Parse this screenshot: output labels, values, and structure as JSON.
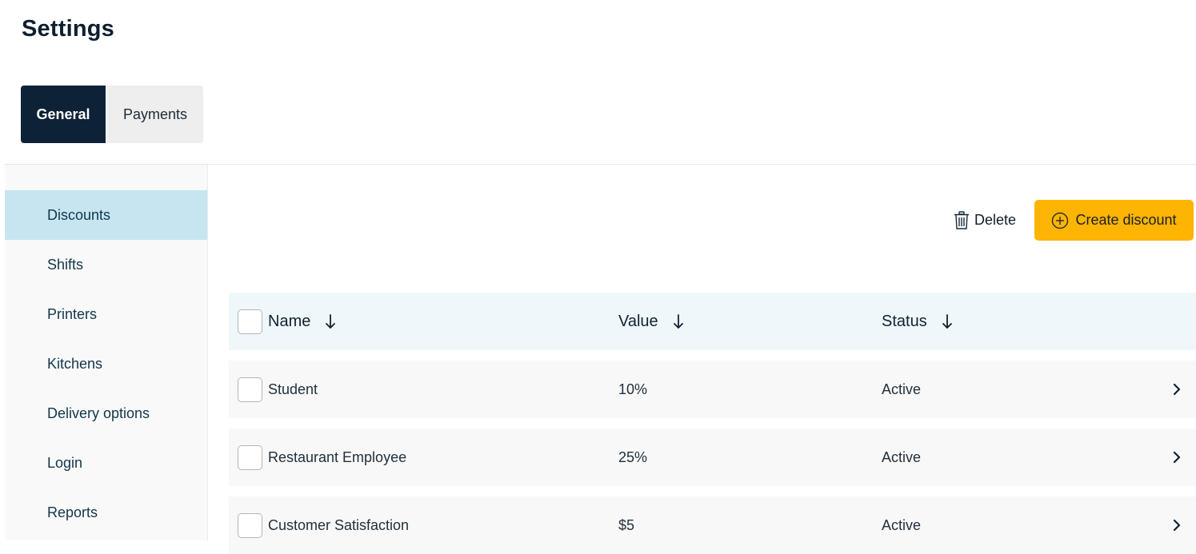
{
  "page": {
    "title": "Settings"
  },
  "tabs": [
    {
      "label": "General",
      "active": true
    },
    {
      "label": "Payments",
      "active": false
    }
  ],
  "sidebar": {
    "items": [
      {
        "label": "Discounts",
        "active": true
      },
      {
        "label": "Shifts"
      },
      {
        "label": "Printers"
      },
      {
        "label": "Kitchens"
      },
      {
        "label": "Delivery options"
      },
      {
        "label": "Login"
      },
      {
        "label": "Reports"
      }
    ]
  },
  "toolbar": {
    "delete_label": "Delete",
    "delete_icon": "trash-icon",
    "create_label": "Create discount",
    "create_icon": "plus-circle-icon"
  },
  "table": {
    "columns": [
      {
        "label": "Name",
        "sort_icon": "arrow-down-icon"
      },
      {
        "label": "Value",
        "sort_icon": "arrow-down-icon"
      },
      {
        "label": "Status",
        "sort_icon": "arrow-down-icon"
      }
    ],
    "rows": [
      {
        "name": "Student",
        "value": "10%",
        "status": "Active"
      },
      {
        "name": "Restaurant Employee",
        "value": "25%",
        "status": "Active"
      },
      {
        "name": "Customer Satisfaction",
        "value": "$5",
        "status": "Active"
      }
    ]
  },
  "colors": {
    "primary_dark": "#0d2237",
    "accent_yellow": "#fdb402",
    "sidebar_active": "#c6e5f0",
    "table_header_bg": "#f0f7fa"
  }
}
